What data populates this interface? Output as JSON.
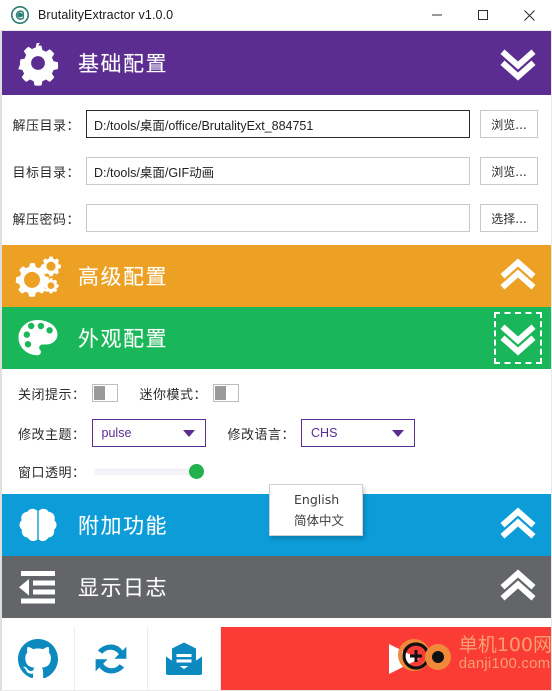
{
  "window": {
    "title": "BrutalityExtractor v1.0.0",
    "app_icon": "app-logo-icon",
    "minimize_label": "—",
    "maximize_label": "□",
    "close_label": "✕"
  },
  "colors": {
    "basic": "#5C2D91",
    "advanced": "#EDA124",
    "appearance": "#19B759",
    "extra": "#0C9CD8",
    "log": "#636569",
    "action": "#FB3B35",
    "toolbar_icon": "#0C8AC0",
    "slider_knob": "#22B14C",
    "combo_accent": "#5C2D91"
  },
  "sections": {
    "basic": {
      "title": "基础配置",
      "icon": "gear-icon",
      "chevron": "chevron-double-down-icon",
      "expanded": true
    },
    "advanced": {
      "title": "高级配置",
      "icon": "gears-icon",
      "chevron": "chevron-double-up-icon",
      "expanded": false
    },
    "appearance": {
      "title": "外观配置",
      "icon": "palette-icon",
      "chevron": "chevron-double-down-icon",
      "expanded": true,
      "chevron_focused": true
    },
    "extra": {
      "title": "附加功能",
      "icon": "brain-icon",
      "chevron": "chevron-double-up-icon",
      "expanded": false
    },
    "log": {
      "title": "显示日志",
      "icon": "indent-list-icon",
      "chevron": "chevron-double-up-icon",
      "expanded": false
    }
  },
  "basic_form": {
    "rows": [
      {
        "label": "解压目录：",
        "value": "D:/tools/桌面/office/BrutalityExt_884751",
        "placeholder": "",
        "button": "浏览...",
        "focused": true
      },
      {
        "label": "目标目录：",
        "value": "D:/tools/桌面/GIF动画",
        "placeholder": "",
        "button": "浏览...",
        "focused": false
      },
      {
        "label": "解压密码：",
        "value": "",
        "placeholder": "",
        "button": "选择...",
        "focused": false
      }
    ]
  },
  "appearance_form": {
    "close_tip": {
      "label": "关闭提示：",
      "state": "off"
    },
    "mini_mode": {
      "label": "迷你模式：",
      "state": "off"
    },
    "theme": {
      "label": "修改主题：",
      "value": "pulse",
      "arrow": "chevron-down-icon"
    },
    "language": {
      "label": "修改语言：",
      "value": "CHS",
      "arrow": "chevron-down-icon",
      "open": true,
      "options": [
        "English",
        "简体中文"
      ]
    },
    "opacity": {
      "label": "窗口透明：",
      "value": 100
    }
  },
  "toolbar": {
    "items": [
      {
        "name": "github-icon",
        "label": "GitHub"
      },
      {
        "name": "refresh-icon",
        "label": "刷新"
      },
      {
        "name": "mail-icon",
        "label": "邮件"
      }
    ],
    "action": {
      "name": "play-icon",
      "label": "开始"
    }
  },
  "watermark": {
    "line1": "单机100网",
    "line2": "danji100.com"
  }
}
